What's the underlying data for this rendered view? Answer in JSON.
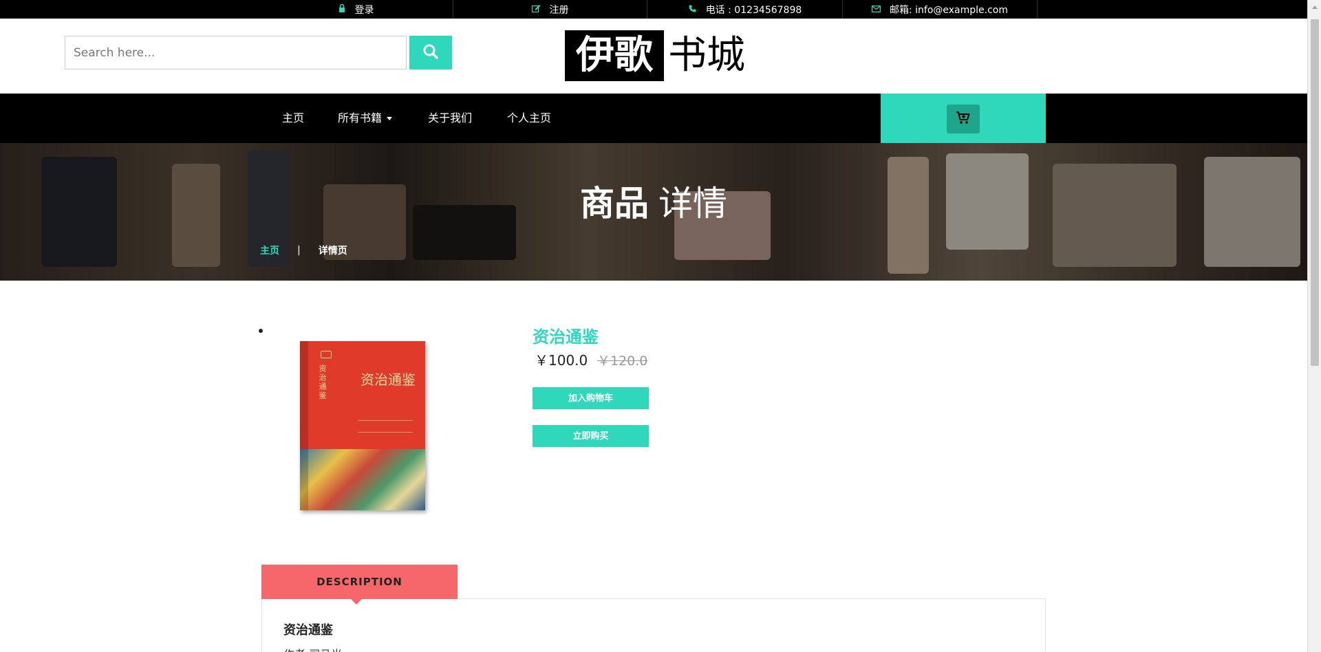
{
  "topbar": {
    "login": "登录",
    "register": "注册",
    "phone": "电话 : 01234567898",
    "email": "邮箱: info@example.com"
  },
  "header": {
    "search_placeholder": "Search here...",
    "logo_bold": "伊歌",
    "logo_light": "书城"
  },
  "nav": {
    "items": [
      {
        "label": "主页"
      },
      {
        "label": "所有书籍"
      },
      {
        "label": "关于我们"
      },
      {
        "label": "个人主页"
      }
    ]
  },
  "hero": {
    "title_bold": "商品",
    "title_light": "详情",
    "breadcrumb_home": "主页",
    "breadcrumb_sep": "|",
    "breadcrumb_current": "详情页"
  },
  "product": {
    "name": "资治通鉴",
    "price": "￥100.0",
    "old_price": "￥120.0",
    "add_to_cart": "加入购物车",
    "buy_now": "立即购买",
    "cover_title": "资治通鉴"
  },
  "description": {
    "tab_label": "DESCRIPTION",
    "title": "资治通鉴",
    "author": "作者:司马光"
  },
  "colors": {
    "accent": "#2fd8ba",
    "tab": "#f5676b",
    "nav_bg": "#000000"
  }
}
